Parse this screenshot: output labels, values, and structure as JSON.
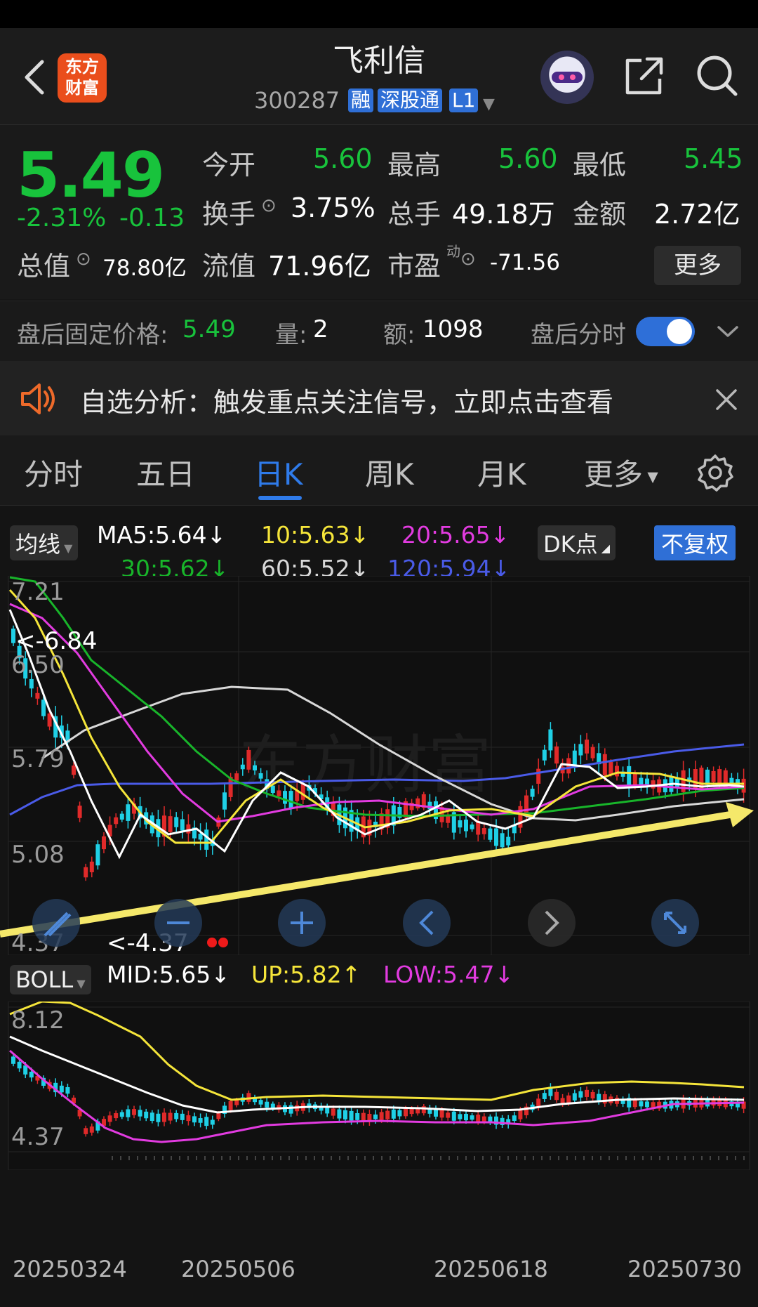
{
  "header": {
    "logo_line1": "东方",
    "logo_line2": "财富",
    "stock_name": "飞利信",
    "stock_code": "300287",
    "badges": [
      "融",
      "深股通",
      "L1"
    ]
  },
  "quote": {
    "price": "5.49",
    "change_pct": "-2.31%",
    "change_amt": "-0.13",
    "open_label": "今开",
    "open": "5.60",
    "high_label": "最高",
    "high": "5.60",
    "low_label": "最低",
    "low": "5.45",
    "turnover_label": "换手",
    "turnover": "3.75%",
    "volume_label": "总手",
    "volume": "49.18万",
    "amount_label": "金额",
    "amount": "2.72亿",
    "mktcap_label": "总值",
    "mktcap": "78.80亿",
    "float_label": "流值",
    "float": "71.96亿",
    "pe_label": "市盈",
    "pe_sup": "动",
    "pe": "-71.56",
    "more_label": "更多"
  },
  "after_hours": {
    "price_label": "盘后固定价格:",
    "price": "5.49",
    "vol_label": "量:",
    "vol": "2",
    "amt_label": "额:",
    "amt": "1098",
    "toggle_label": "盘后分时",
    "toggle_on": true
  },
  "banner": {
    "text": "自选分析：触发重点关注信号，立即点击查看"
  },
  "tabs": [
    "分时",
    "五日",
    "日K",
    "周K",
    "月K",
    "更多"
  ],
  "active_tab": "日K",
  "ma_panel": {
    "selector": "均线",
    "ma5": "MA5:5.64↓",
    "ma10": "10:5.63↓",
    "ma20": "20:5.65↓",
    "ma30": "30:5.62↓",
    "ma60": "60:5.52↓",
    "ma120": "120:5.94↓",
    "dk_label": "DK点",
    "adjust_label": "不复权",
    "colors": {
      "ma5": "#ffffff",
      "ma10": "#f5e53a",
      "ma20": "#e23be0",
      "ma30": "#18b52a",
      "ma60": "#d8d8d8",
      "ma120": "#4a5be8"
    }
  },
  "boll_panel": {
    "selector": "BOLL",
    "mid": "MID:5.65↓",
    "up": "UP:5.82↑",
    "low": "LOW:5.47↓"
  },
  "chart_data": {
    "type": "candlestick",
    "y_axis_main": [
      "7.21",
      "6.50",
      "5.79",
      "5.08",
      "4.37"
    ],
    "y_axis_boll": [
      "8.12",
      "4.37"
    ],
    "high_marker": "<-6.84",
    "low_marker": "<-4.37",
    "x_labels": [
      "20250324",
      "20250506",
      "20250618",
      "20250730"
    ]
  },
  "toolbar_icons": [
    "pen-icon",
    "minus-icon",
    "plus-icon",
    "chevron-left-icon",
    "chevron-right-icon",
    "expand-icon"
  ]
}
